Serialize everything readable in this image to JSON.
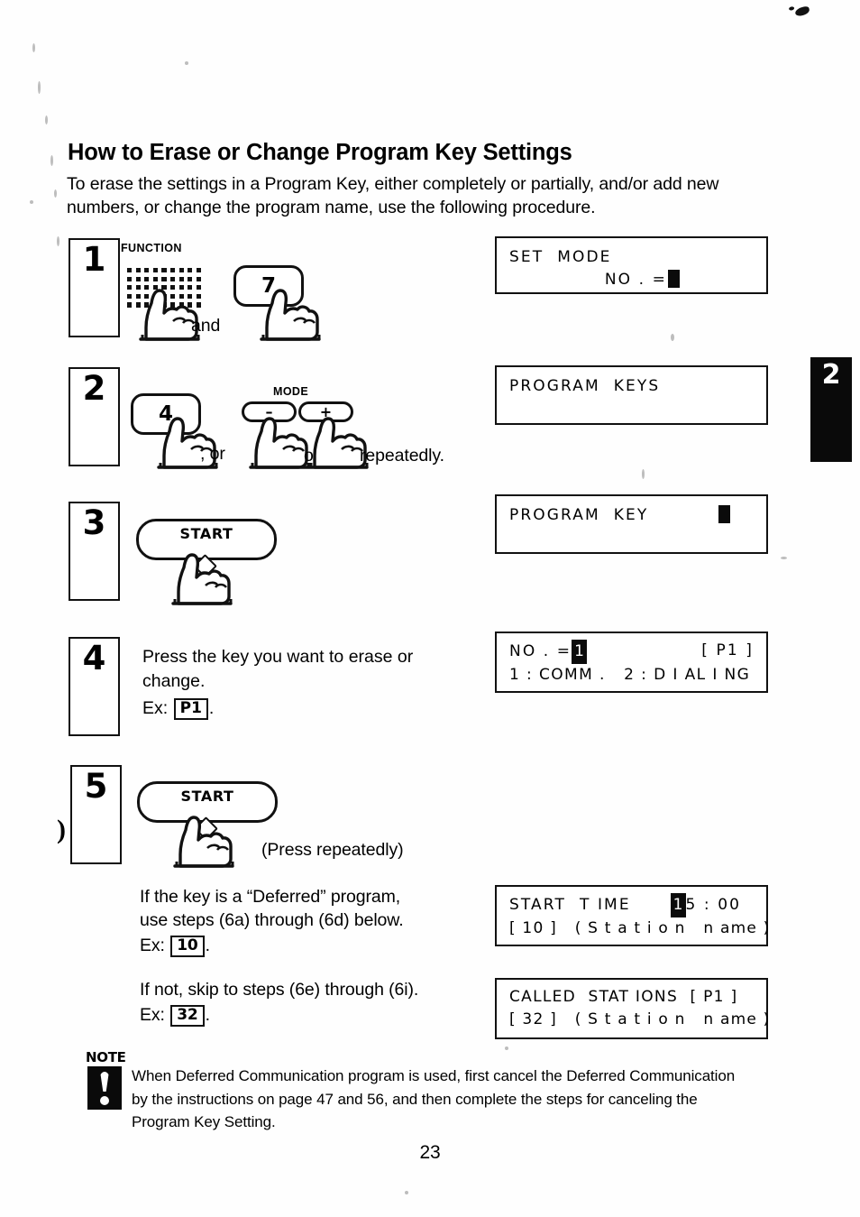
{
  "page": {
    "title": "How to Erase or Change Program Key Settings",
    "intro": "To erase the settings in a Program Key, either completely or partially, and/or add new numbers, or change the program name, use the following procedure.",
    "page_number": "23",
    "chapter_tab": "2"
  },
  "steps": [
    {
      "number": "1"
    },
    {
      "number": "2"
    },
    {
      "number": "3"
    },
    {
      "number": "4"
    },
    {
      "number": "5"
    }
  ],
  "step1": {
    "function_label": "FUNCTION",
    "key_7": "7",
    "and_text": "and"
  },
  "step2": {
    "key_4": "4",
    "mode_label": "MODE",
    "mode_minus": "–",
    "mode_plus": "+",
    "or_text_1": ", or",
    "or_text_2": "or",
    "repeatedly_text": "repeatedly."
  },
  "step3": {
    "start_key": "START"
  },
  "step4": {
    "line1": "Press the key you want to erase or",
    "line2": "change.",
    "ex_prefix": "Ex:",
    "ex_value": "P1",
    "ex_suffix": "."
  },
  "step5": {
    "start_key": "START",
    "press_repeatedly": "(Press repeatedly)",
    "deferred_line1": "If the key is a “Deferred” program,",
    "deferred_line2": "use steps (6a) through (6d) below.",
    "deferred_ex_prefix": "Ex:",
    "deferred_ex_value": "10",
    "deferred_ex_suffix": ".",
    "notdeferred_line1": "If not, skip to steps (6e) through (6i).",
    "notdeferred_ex_prefix": "Ex:",
    "notdeferred_ex_value": "32",
    "notdeferred_ex_suffix": "."
  },
  "displays": {
    "d1": {
      "line1": "SET  MODE",
      "line2_label": "NO . ="
    },
    "d2": {
      "line1": "PROGRAM  KEYS"
    },
    "d3": {
      "line1": "PROGRAM  KEY"
    },
    "d4": {
      "line1_label": "NO . =",
      "line1_cursor": "1",
      "line1_right": "[ P1 ]",
      "line2": "1 : COMM .   2 : D I AL I NG"
    },
    "d5": {
      "line1_label": "START  T IME",
      "line1_cursor": "1",
      "line1_rest": "5 : 00",
      "line2": "[ 10 ]   ( S t a t i o n   n ame )"
    },
    "d6": {
      "line1": "CALLED  STAT IONS  [ P1 ]",
      "line2": "[ 32 ]   ( S t a t i o n   n ame )"
    }
  },
  "note": {
    "label": "NOTE",
    "body": "When Deferred Communication program is used, first cancel the Deferred Communication by the instructions on page 47 and 56, and then complete the steps for canceling the Program Key Setting."
  }
}
